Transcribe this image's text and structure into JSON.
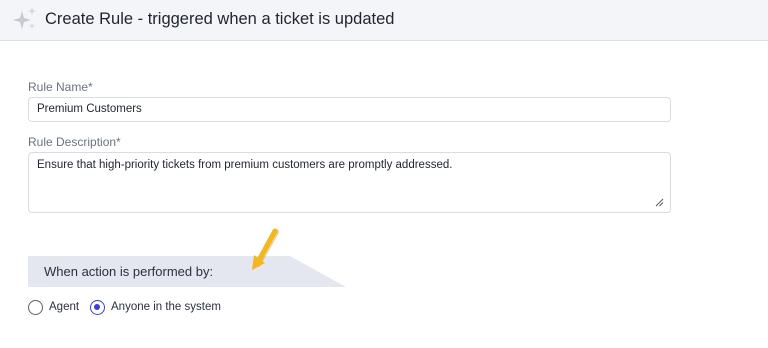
{
  "header": {
    "title": "Create Rule - triggered when a ticket is updated",
    "icon": "sparkle-icon"
  },
  "form": {
    "rule_name": {
      "label": "Rule Name*",
      "value": "Premium Customers"
    },
    "rule_description": {
      "label": "Rule Description*",
      "value": "Ensure that high-priority tickets from premium customers are promptly addressed."
    }
  },
  "performed_by": {
    "heading": "When action is performed by:",
    "options": [
      {
        "label": "Agent",
        "selected": false
      },
      {
        "label": "Anyone in the system",
        "selected": true
      }
    ]
  },
  "colors": {
    "accent": "#3a3fd8",
    "band": "#e4e6f0",
    "arrow": "#f2b81c"
  }
}
